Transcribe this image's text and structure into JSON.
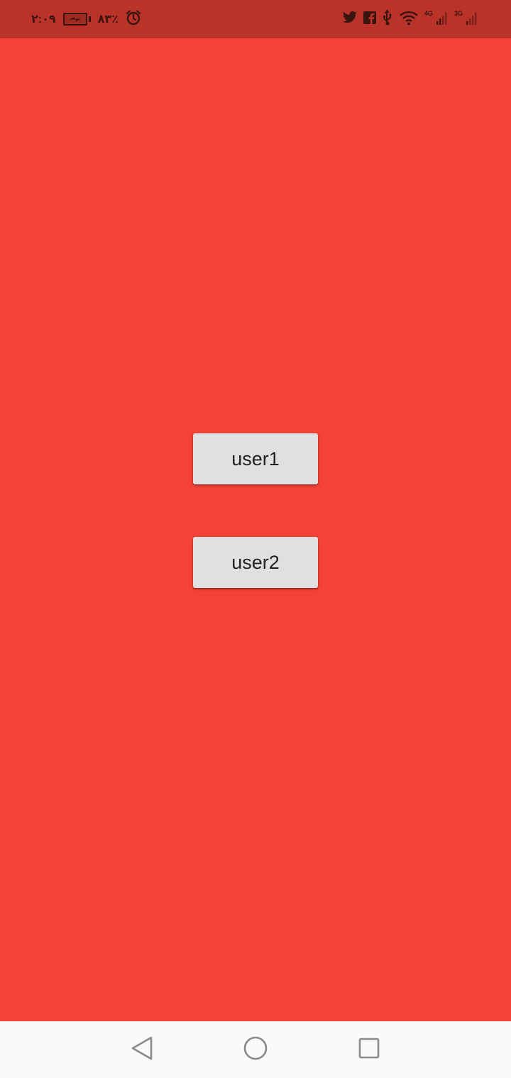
{
  "theme": {
    "background": "#f44336",
    "status_bar": "#ba3329",
    "button_bg": "#e0e0e0",
    "nav_bar": "#fafafa"
  },
  "status_bar": {
    "time": "٢:٠٩",
    "battery_percent": "٪٨٣",
    "network_1": "4G",
    "network_2": "3G",
    "icons": [
      "twitter-icon",
      "facebook-icon",
      "usb-icon",
      "wifi-icon",
      "signal-icon",
      "signal-icon",
      "battery-charging-icon",
      "alarm-icon"
    ]
  },
  "main": {
    "buttons": [
      {
        "label": "user1"
      },
      {
        "label": "user2"
      }
    ]
  },
  "nav_bar": {
    "icons": [
      "back-icon",
      "home-icon",
      "recents-icon"
    ]
  }
}
